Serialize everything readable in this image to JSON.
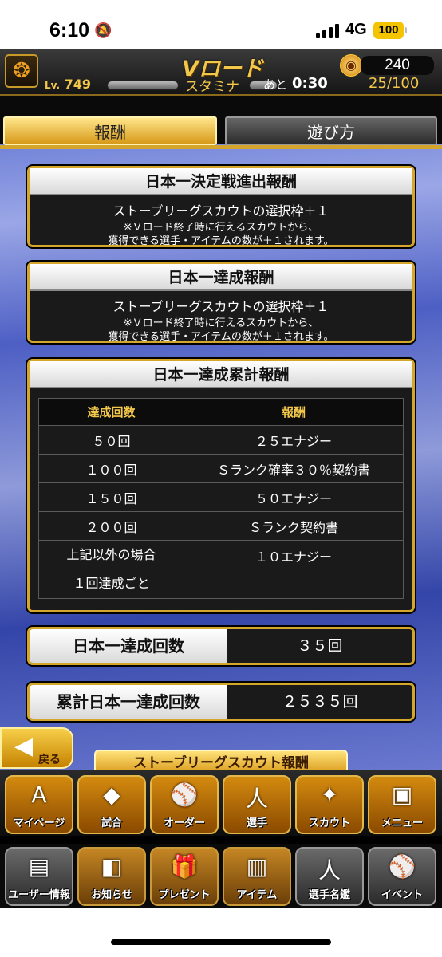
{
  "status": {
    "time": "6:10",
    "network": "4G",
    "battery": "100"
  },
  "header": {
    "title": "Vロード",
    "coins": "240",
    "level_prefix": "Lv.",
    "level": "749",
    "stamina_label": "スタミナ",
    "time_prefix": "あと",
    "timer": "0:30",
    "stamina": "25/100"
  },
  "tabs": {
    "reward": "報酬",
    "howto": "遊び方"
  },
  "panels": {
    "p1": {
      "title": "日本一決定戦進出報酬",
      "line": "ストーブリーグスカウトの選択枠＋１",
      "note1": "※Ｖロード終了時に行えるスカウトから、",
      "note2": "獲得できる選手・アイテムの数が＋１されます。"
    },
    "p2": {
      "title": "日本一達成報酬",
      "line": "ストーブリーグスカウトの選択枠＋１",
      "note1": "※Ｖロード終了時に行えるスカウトから、",
      "note2": "獲得できる選手・アイテムの数が＋１されます。"
    },
    "p3": {
      "title": "日本一達成累計報酬",
      "headers": [
        "達成回数",
        "報酬"
      ],
      "rows": [
        [
          "５０回",
          "２５エナジー"
        ],
        [
          "１００回",
          "Ｓランク確率３０％契約書"
        ],
        [
          "１５０回",
          "５０エナジー"
        ],
        [
          "２００回",
          "Ｓランク契約書"
        ]
      ],
      "last_count_1": "上記以外の場合",
      "last_count_2": "１回達成ごと",
      "last_reward": "１０エナジー"
    }
  },
  "counts": {
    "wins_label": "日本一達成回数",
    "wins_value": "３５回",
    "total_label": "累計日本一達成回数",
    "total_value": "２５３５回"
  },
  "buttons": {
    "back": "戻る",
    "scout": "ストーブリーグスカウト報酬"
  },
  "nav1": [
    {
      "icon": "A",
      "label": "マイページ"
    },
    {
      "icon": "◆",
      "label": "試合"
    },
    {
      "icon": "⚾",
      "label": "オーダー"
    },
    {
      "icon": "人",
      "label": "選手"
    },
    {
      "icon": "✦",
      "label": "スカウト"
    },
    {
      "icon": "▣",
      "label": "メニュー"
    }
  ],
  "nav2": [
    {
      "icon": "▤",
      "label": "ユーザー情報"
    },
    {
      "icon": "◧",
      "label": "お知らせ"
    },
    {
      "icon": "🎁",
      "label": "プレゼント"
    },
    {
      "icon": "▥",
      "label": "アイテム"
    },
    {
      "icon": "人",
      "label": "選手名鑑"
    },
    {
      "icon": "⚾",
      "label": "イベント"
    }
  ],
  "colors": {
    "gold": "#d4a72c",
    "accent": "#f3c84a",
    "bg_blue": "#5a6fd0"
  }
}
